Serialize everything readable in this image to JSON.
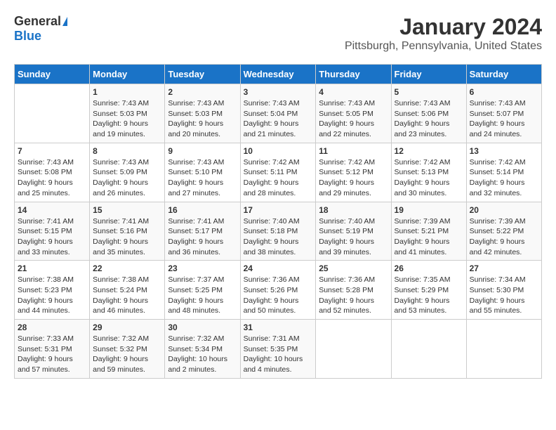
{
  "logo": {
    "general": "General",
    "blue": "Blue"
  },
  "title": "January 2024",
  "location": "Pittsburgh, Pennsylvania, United States",
  "days_header": [
    "Sunday",
    "Monday",
    "Tuesday",
    "Wednesday",
    "Thursday",
    "Friday",
    "Saturday"
  ],
  "weeks": [
    [
      {
        "day": "",
        "sunrise": "",
        "sunset": "",
        "daylight": ""
      },
      {
        "day": "1",
        "sunrise": "Sunrise: 7:43 AM",
        "sunset": "Sunset: 5:03 PM",
        "daylight": "Daylight: 9 hours and 19 minutes."
      },
      {
        "day": "2",
        "sunrise": "Sunrise: 7:43 AM",
        "sunset": "Sunset: 5:03 PM",
        "daylight": "Daylight: 9 hours and 20 minutes."
      },
      {
        "day": "3",
        "sunrise": "Sunrise: 7:43 AM",
        "sunset": "Sunset: 5:04 PM",
        "daylight": "Daylight: 9 hours and 21 minutes."
      },
      {
        "day": "4",
        "sunrise": "Sunrise: 7:43 AM",
        "sunset": "Sunset: 5:05 PM",
        "daylight": "Daylight: 9 hours and 22 minutes."
      },
      {
        "day": "5",
        "sunrise": "Sunrise: 7:43 AM",
        "sunset": "Sunset: 5:06 PM",
        "daylight": "Daylight: 9 hours and 23 minutes."
      },
      {
        "day": "6",
        "sunrise": "Sunrise: 7:43 AM",
        "sunset": "Sunset: 5:07 PM",
        "daylight": "Daylight: 9 hours and 24 minutes."
      }
    ],
    [
      {
        "day": "7",
        "sunrise": "Sunrise: 7:43 AM",
        "sunset": "Sunset: 5:08 PM",
        "daylight": "Daylight: 9 hours and 25 minutes."
      },
      {
        "day": "8",
        "sunrise": "Sunrise: 7:43 AM",
        "sunset": "Sunset: 5:09 PM",
        "daylight": "Daylight: 9 hours and 26 minutes."
      },
      {
        "day": "9",
        "sunrise": "Sunrise: 7:43 AM",
        "sunset": "Sunset: 5:10 PM",
        "daylight": "Daylight: 9 hours and 27 minutes."
      },
      {
        "day": "10",
        "sunrise": "Sunrise: 7:42 AM",
        "sunset": "Sunset: 5:11 PM",
        "daylight": "Daylight: 9 hours and 28 minutes."
      },
      {
        "day": "11",
        "sunrise": "Sunrise: 7:42 AM",
        "sunset": "Sunset: 5:12 PM",
        "daylight": "Daylight: 9 hours and 29 minutes."
      },
      {
        "day": "12",
        "sunrise": "Sunrise: 7:42 AM",
        "sunset": "Sunset: 5:13 PM",
        "daylight": "Daylight: 9 hours and 30 minutes."
      },
      {
        "day": "13",
        "sunrise": "Sunrise: 7:42 AM",
        "sunset": "Sunset: 5:14 PM",
        "daylight": "Daylight: 9 hours and 32 minutes."
      }
    ],
    [
      {
        "day": "14",
        "sunrise": "Sunrise: 7:41 AM",
        "sunset": "Sunset: 5:15 PM",
        "daylight": "Daylight: 9 hours and 33 minutes."
      },
      {
        "day": "15",
        "sunrise": "Sunrise: 7:41 AM",
        "sunset": "Sunset: 5:16 PM",
        "daylight": "Daylight: 9 hours and 35 minutes."
      },
      {
        "day": "16",
        "sunrise": "Sunrise: 7:41 AM",
        "sunset": "Sunset: 5:17 PM",
        "daylight": "Daylight: 9 hours and 36 minutes."
      },
      {
        "day": "17",
        "sunrise": "Sunrise: 7:40 AM",
        "sunset": "Sunset: 5:18 PM",
        "daylight": "Daylight: 9 hours and 38 minutes."
      },
      {
        "day": "18",
        "sunrise": "Sunrise: 7:40 AM",
        "sunset": "Sunset: 5:19 PM",
        "daylight": "Daylight: 9 hours and 39 minutes."
      },
      {
        "day": "19",
        "sunrise": "Sunrise: 7:39 AM",
        "sunset": "Sunset: 5:21 PM",
        "daylight": "Daylight: 9 hours and 41 minutes."
      },
      {
        "day": "20",
        "sunrise": "Sunrise: 7:39 AM",
        "sunset": "Sunset: 5:22 PM",
        "daylight": "Daylight: 9 hours and 42 minutes."
      }
    ],
    [
      {
        "day": "21",
        "sunrise": "Sunrise: 7:38 AM",
        "sunset": "Sunset: 5:23 PM",
        "daylight": "Daylight: 9 hours and 44 minutes."
      },
      {
        "day": "22",
        "sunrise": "Sunrise: 7:38 AM",
        "sunset": "Sunset: 5:24 PM",
        "daylight": "Daylight: 9 hours and 46 minutes."
      },
      {
        "day": "23",
        "sunrise": "Sunrise: 7:37 AM",
        "sunset": "Sunset: 5:25 PM",
        "daylight": "Daylight: 9 hours and 48 minutes."
      },
      {
        "day": "24",
        "sunrise": "Sunrise: 7:36 AM",
        "sunset": "Sunset: 5:26 PM",
        "daylight": "Daylight: 9 hours and 50 minutes."
      },
      {
        "day": "25",
        "sunrise": "Sunrise: 7:36 AM",
        "sunset": "Sunset: 5:28 PM",
        "daylight": "Daylight: 9 hours and 52 minutes."
      },
      {
        "day": "26",
        "sunrise": "Sunrise: 7:35 AM",
        "sunset": "Sunset: 5:29 PM",
        "daylight": "Daylight: 9 hours and 53 minutes."
      },
      {
        "day": "27",
        "sunrise": "Sunrise: 7:34 AM",
        "sunset": "Sunset: 5:30 PM",
        "daylight": "Daylight: 9 hours and 55 minutes."
      }
    ],
    [
      {
        "day": "28",
        "sunrise": "Sunrise: 7:33 AM",
        "sunset": "Sunset: 5:31 PM",
        "daylight": "Daylight: 9 hours and 57 minutes."
      },
      {
        "day": "29",
        "sunrise": "Sunrise: 7:32 AM",
        "sunset": "Sunset: 5:32 PM",
        "daylight": "Daylight: 9 hours and 59 minutes."
      },
      {
        "day": "30",
        "sunrise": "Sunrise: 7:32 AM",
        "sunset": "Sunset: 5:34 PM",
        "daylight": "Daylight: 10 hours and 2 minutes."
      },
      {
        "day": "31",
        "sunrise": "Sunrise: 7:31 AM",
        "sunset": "Sunset: 5:35 PM",
        "daylight": "Daylight: 10 hours and 4 minutes."
      },
      {
        "day": "",
        "sunrise": "",
        "sunset": "",
        "daylight": ""
      },
      {
        "day": "",
        "sunrise": "",
        "sunset": "",
        "daylight": ""
      },
      {
        "day": "",
        "sunrise": "",
        "sunset": "",
        "daylight": ""
      }
    ]
  ]
}
